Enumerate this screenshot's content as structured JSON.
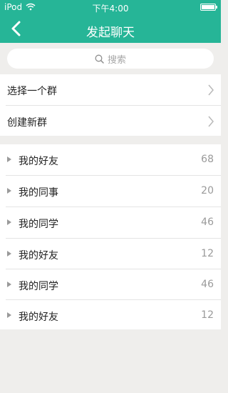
{
  "status": {
    "carrier": "iPod",
    "time": "下午4:00"
  },
  "nav": {
    "title": "发起聊天",
    "back_icon": "chevron-left-icon"
  },
  "search": {
    "placeholder": "搜索",
    "icon": "search-icon"
  },
  "groups": [
    {
      "label": "选择一个群"
    },
    {
      "label": "创建新群"
    }
  ],
  "friend_groups": [
    {
      "label": "我的好友",
      "count": "68"
    },
    {
      "label": "我的同事",
      "count": "20"
    },
    {
      "label": "我的同学",
      "count": "46"
    },
    {
      "label": "我的好友",
      "count": "12"
    },
    {
      "label": "我的同学",
      "count": "46"
    },
    {
      "label": "我的好友",
      "count": "12"
    }
  ],
  "colors": {
    "accent": "#26b597",
    "background": "#efeeec"
  }
}
